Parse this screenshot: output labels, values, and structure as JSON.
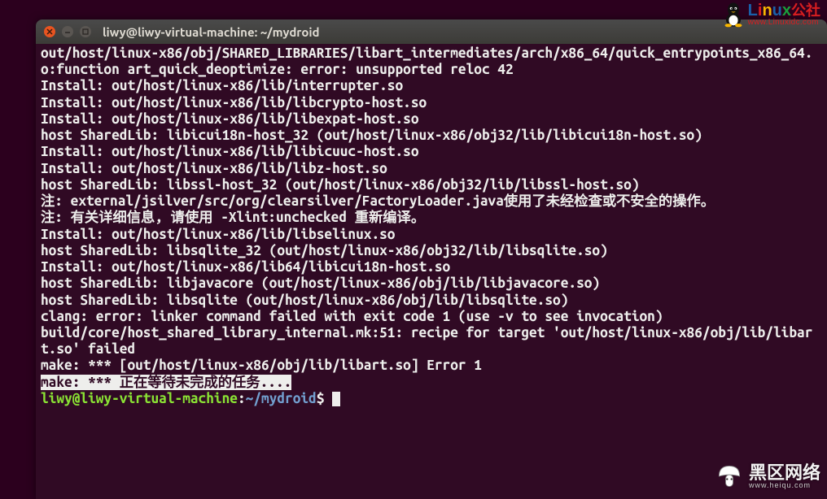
{
  "window": {
    "title": "liwy@liwy-virtual-machine: ~/mydroid"
  },
  "terminal": {
    "lines": [
      "out/host/linux-x86/obj/SHARED_LIBRARIES/libart_intermediates/arch/x86_64/quick_entrypoints_x86_64.o:function art_quick_deoptimize: error: unsupported reloc 42",
      "Install: out/host/linux-x86/lib/interrupter.so",
      "Install: out/host/linux-x86/lib/libcrypto-host.so",
      "Install: out/host/linux-x86/lib/libexpat-host.so",
      "host SharedLib: libicui18n-host_32 (out/host/linux-x86/obj32/lib/libicui18n-host.so)",
      "Install: out/host/linux-x86/lib/libicuuc-host.so",
      "Install: out/host/linux-x86/lib/libz-host.so",
      "host SharedLib: libssl-host_32 (out/host/linux-x86/obj32/lib/libssl-host.so)",
      "注: external/jsilver/src/org/clearsilver/FactoryLoader.java使用了未经检查或不安全的操作。",
      "注: 有关详细信息, 请使用 -Xlint:unchecked 重新编译。",
      "Install: out/host/linux-x86/lib/libselinux.so",
      "host SharedLib: libsqlite_32 (out/host/linux-x86/obj32/lib/libsqlite.so)",
      "Install: out/host/linux-x86/lib64/libicui18n-host.so",
      "host SharedLib: libjavacore (out/host/linux-x86/obj/lib/libjavacore.so)",
      "host SharedLib: libsqlite (out/host/linux-x86/obj/lib/libsqlite.so)",
      "clang: error: linker command failed with exit code 1 (use -v to see invocation)",
      "build/core/host_shared_library_internal.mk:51: recipe for target 'out/host/linux-x86/obj/lib/libart.so' failed",
      "make: *** [out/host/linux-x86/obj/lib/libart.so] Error 1"
    ],
    "selected_line": "make: *** 正在等待未完成的任务....",
    "prompt": {
      "user_host": "liwy@liwy-virtual-machine",
      "colon": ":",
      "path": "~/mydroid",
      "dollar": "$"
    }
  },
  "watermark1": {
    "brand_letters": [
      "L",
      "i",
      "n",
      "u",
      "x"
    ],
    "brand_cn": "公社",
    "url": "www.Linuxidc.com"
  },
  "watermark2": {
    "brand": "黑区网络",
    "url": "www.heiqu.com"
  }
}
